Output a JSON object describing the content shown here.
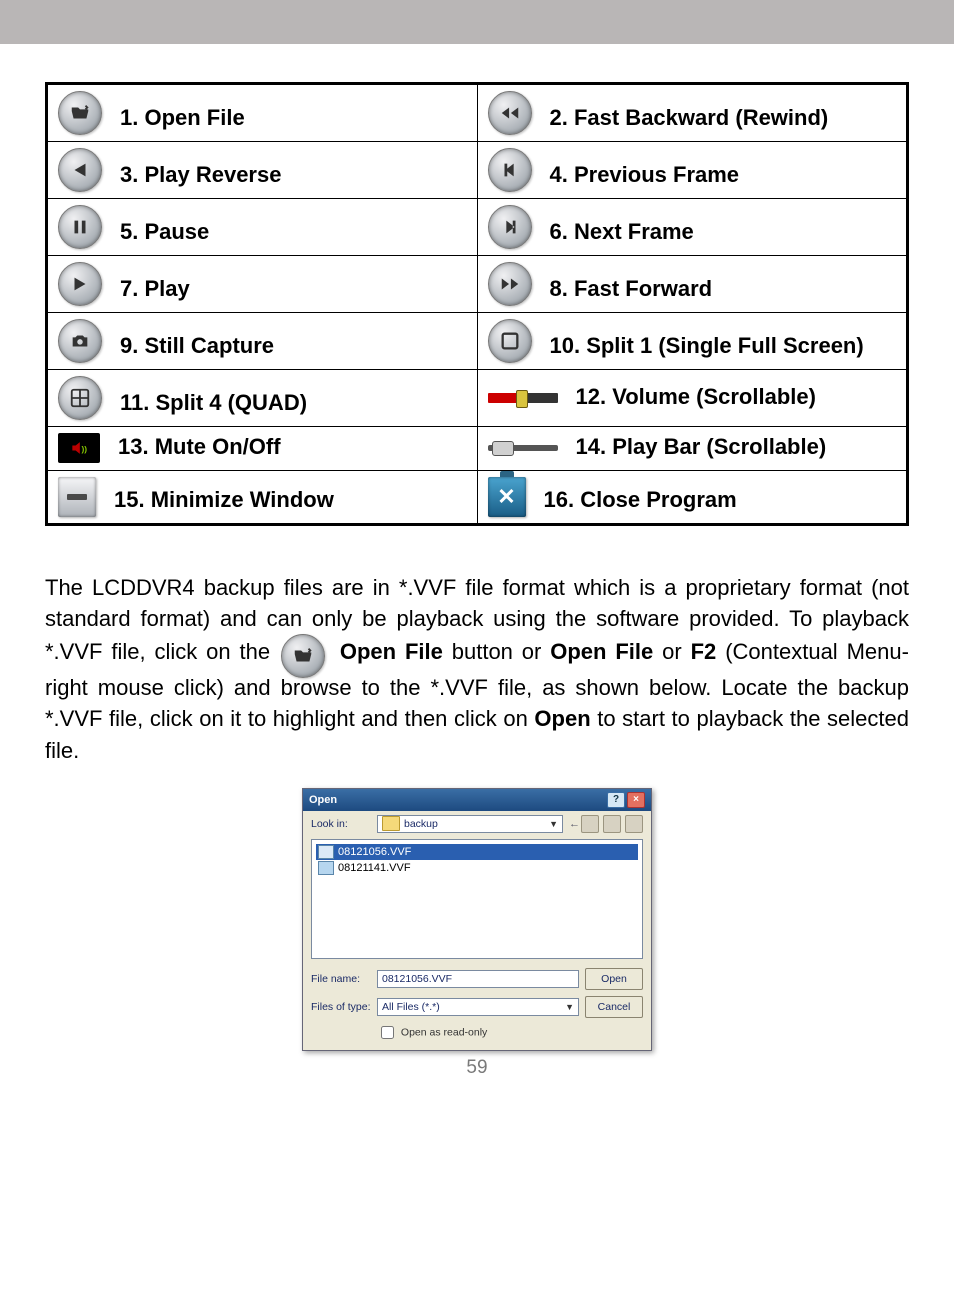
{
  "table": {
    "r1c1": "1. Open File",
    "r1c2": "2. Fast Backward (Rewind)",
    "r2c1": "3. Play Reverse",
    "r2c2": "4. Previous Frame",
    "r3c1": "5. Pause",
    "r3c2": "6. Next Frame",
    "r4c1": "7. Play",
    "r4c2": "8. Fast Forward",
    "r5c1": "9. Still Capture",
    "r5c2": "10. Split 1 (Single Full Screen)",
    "r6c1": "11. Split 4 (QUAD)",
    "r6c2": "12. Volume (Scrollable)",
    "r7c1": "13. Mute On/Off",
    "r7c2": "14. Play Bar (Scrollable)",
    "r8c1": "15. Minimize Window",
    "r8c2": "16. Close Program"
  },
  "body": {
    "p1a": "The LCDDVR4 backup files are in *.VVF file format which is a proprietary format (not standard format) and can only be playback using the software provided.   To playback *.VVF file, click on the ",
    "p1b_bold1": "Open File",
    "p1b_mid1": " button or ",
    "p1b_bold2": "Open File",
    "p1b_mid2": " or ",
    "p1b_bold3": "F2",
    "p1c": " (Contextual Menu-right mouse click) and browse to the *.VVF file, as shown below.  Locate the backup *.VVF file, click on it to highlight and then click on ",
    "p1d_bold": "Open",
    "p1e": " to start to playback the selected file."
  },
  "dialog": {
    "title": "Open",
    "look_in_label": "Look in:",
    "look_in_value": "backup",
    "files": [
      {
        "name": "08121056.VVF",
        "selected": true
      },
      {
        "name": "08121141.VVF",
        "selected": false
      }
    ],
    "filename_label": "File name:",
    "filename_value": "08121056.VVF",
    "filetype_label": "Files of type:",
    "filetype_value": "All Files (*.*)",
    "open_btn": "Open",
    "cancel_btn": "Cancel",
    "readonly_label": "Open as read-only"
  },
  "page_number": "59"
}
